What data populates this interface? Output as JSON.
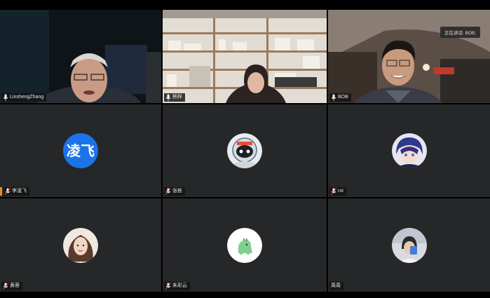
{
  "app": {
    "background": "#000000",
    "tile_color": "#262729",
    "active_speaker_color": "#36c04a"
  },
  "speaking_banner": "正在讲话: BOB;",
  "participants": [
    {
      "name": "LinshengZhang",
      "type": "video",
      "mic": "on"
    },
    {
      "name": "熊样",
      "type": "video",
      "mic": "on"
    },
    {
      "name": "BOB",
      "type": "video",
      "mic": "on",
      "active": true
    },
    {
      "name": "李凌飞",
      "type": "avatar",
      "avatar_text": "凌飞",
      "avatar_color": "#1a73e8",
      "mic": "muted"
    },
    {
      "name": "张栋",
      "type": "avatar",
      "avatar_icon": "astronaut-avatar-icon",
      "mic": "muted"
    },
    {
      "name": "roi",
      "type": "avatar",
      "avatar_icon": "anime-character-avatar-icon",
      "mic": "muted"
    },
    {
      "name": "黄蓉",
      "type": "avatar",
      "avatar_icon": "illustrated-woman-avatar-icon",
      "mic": "muted"
    },
    {
      "name": "朱彩云",
      "type": "avatar",
      "avatar_icon": "green-dinosaur-avatar-icon",
      "mic": "muted"
    },
    {
      "name": "周周",
      "type": "avatar",
      "avatar_icon": "person-photo-avatar-icon",
      "mic": "none"
    }
  ]
}
